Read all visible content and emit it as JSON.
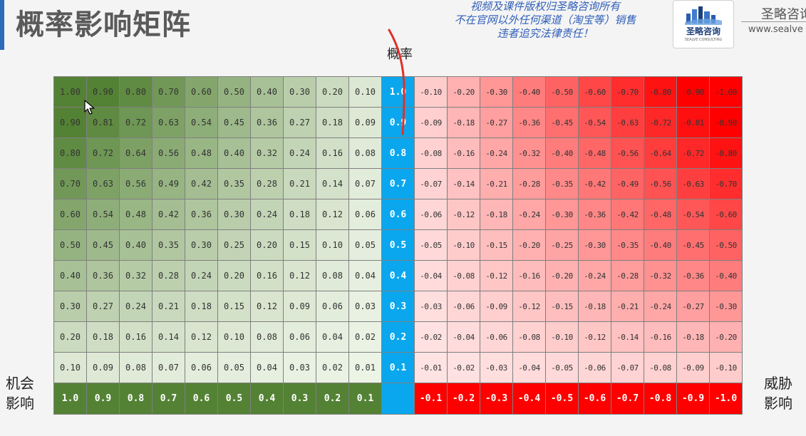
{
  "header": {
    "title": "概率影响矩阵",
    "copyright_lines": [
      "视频及课件版权归圣略咨询所有",
      "不在官网以外任何渠道（淘宝等）销售",
      "违者追究法律责任！"
    ],
    "logo_text": "圣略咨询",
    "logo_sub": "SEALVE CONSULTING",
    "brand_name": "圣略咨询",
    "brand_url": "www.sealve"
  },
  "labels": {
    "probability": "概率",
    "opportunity_line1": "机会",
    "opportunity_line2": "影响",
    "threat_line1": "威胁",
    "threat_line2": "影响"
  },
  "colors": {
    "probability_column": "#0aa7ee",
    "opportunity_dark": "#548235",
    "threat_dark": "#ff0000"
  },
  "chart_data": {
    "type": "heatmap",
    "probabilities": [
      1.0,
      0.9,
      0.8,
      0.7,
      0.6,
      0.5,
      0.4,
      0.3,
      0.2,
      0.1
    ],
    "probability_labels": [
      "1.0",
      "0.9",
      "0.8",
      "0.7",
      "0.6",
      "0.5",
      "0.4",
      "0.3",
      "0.2",
      "0.1"
    ],
    "opportunity_impacts": [
      "1.0",
      "0.9",
      "0.8",
      "0.7",
      "0.6",
      "0.5",
      "0.4",
      "0.3",
      "0.2",
      "0.1"
    ],
    "threat_impacts": [
      "-0.1",
      "-0.2",
      "-0.3",
      "-0.4",
      "-0.5",
      "-0.6",
      "-0.7",
      "-0.8",
      "-0.9",
      "-1.0"
    ],
    "opportunity_values": [
      [
        "1.00",
        "0.90",
        "0.80",
        "0.70",
        "0.60",
        "0.50",
        "0.40",
        "0.30",
        "0.20",
        "0.10"
      ],
      [
        "0.90",
        "0.81",
        "0.72",
        "0.63",
        "0.54",
        "0.45",
        "0.36",
        "0.27",
        "0.18",
        "0.09"
      ],
      [
        "0.80",
        "0.72",
        "0.64",
        "0.56",
        "0.48",
        "0.40",
        "0.32",
        "0.24",
        "0.16",
        "0.08"
      ],
      [
        "0.70",
        "0.63",
        "0.56",
        "0.49",
        "0.42",
        "0.35",
        "0.28",
        "0.21",
        "0.14",
        "0.07"
      ],
      [
        "0.60",
        "0.54",
        "0.48",
        "0.42",
        "0.36",
        "0.30",
        "0.24",
        "0.18",
        "0.12",
        "0.06"
      ],
      [
        "0.50",
        "0.45",
        "0.40",
        "0.35",
        "0.30",
        "0.25",
        "0.20",
        "0.15",
        "0.10",
        "0.05"
      ],
      [
        "0.40",
        "0.36",
        "0.32",
        "0.28",
        "0.24",
        "0.20",
        "0.16",
        "0.12",
        "0.08",
        "0.04"
      ],
      [
        "0.30",
        "0.27",
        "0.24",
        "0.21",
        "0.18",
        "0.15",
        "0.12",
        "0.09",
        "0.06",
        "0.03"
      ],
      [
        "0.20",
        "0.18",
        "0.16",
        "0.14",
        "0.12",
        "0.10",
        "0.08",
        "0.06",
        "0.04",
        "0.02"
      ],
      [
        "0.10",
        "0.09",
        "0.08",
        "0.07",
        "0.06",
        "0.05",
        "0.04",
        "0.03",
        "0.02",
        "0.01"
      ]
    ],
    "threat_values": [
      [
        "-0.10",
        "-0.20",
        "-0.30",
        "-0.40",
        "-0.50",
        "-0.60",
        "-0.70",
        "-0.80",
        "-0.90",
        "-1.00"
      ],
      [
        "-0.09",
        "-0.18",
        "-0.27",
        "-0.36",
        "-0.45",
        "-0.54",
        "-0.63",
        "-0.72",
        "-0.81",
        "-0.90"
      ],
      [
        "-0.08",
        "-0.16",
        "-0.24",
        "-0.32",
        "-0.40",
        "-0.48",
        "-0.56",
        "-0.64",
        "-0.72",
        "-0.80"
      ],
      [
        "-0.07",
        "-0.14",
        "-0.21",
        "-0.28",
        "-0.35",
        "-0.42",
        "-0.49",
        "-0.56",
        "-0.63",
        "-0.70"
      ],
      [
        "-0.06",
        "-0.12",
        "-0.18",
        "-0.24",
        "-0.30",
        "-0.36",
        "-0.42",
        "-0.48",
        "-0.54",
        "-0.60"
      ],
      [
        "-0.05",
        "-0.10",
        "-0.15",
        "-0.20",
        "-0.25",
        "-0.30",
        "-0.35",
        "-0.40",
        "-0.45",
        "-0.50"
      ],
      [
        "-0.04",
        "-0.08",
        "-0.12",
        "-0.16",
        "-0.20",
        "-0.24",
        "-0.28",
        "-0.32",
        "-0.36",
        "-0.40"
      ],
      [
        "-0.03",
        "-0.06",
        "-0.09",
        "-0.12",
        "-0.15",
        "-0.18",
        "-0.21",
        "-0.24",
        "-0.27",
        "-0.30"
      ],
      [
        "-0.02",
        "-0.04",
        "-0.06",
        "-0.08",
        "-0.10",
        "-0.12",
        "-0.14",
        "-0.16",
        "-0.18",
        "-0.20"
      ],
      [
        "-0.01",
        "-0.02",
        "-0.03",
        "-0.04",
        "-0.05",
        "-0.06",
        "-0.07",
        "-0.08",
        "-0.09",
        "-0.10"
      ]
    ]
  }
}
